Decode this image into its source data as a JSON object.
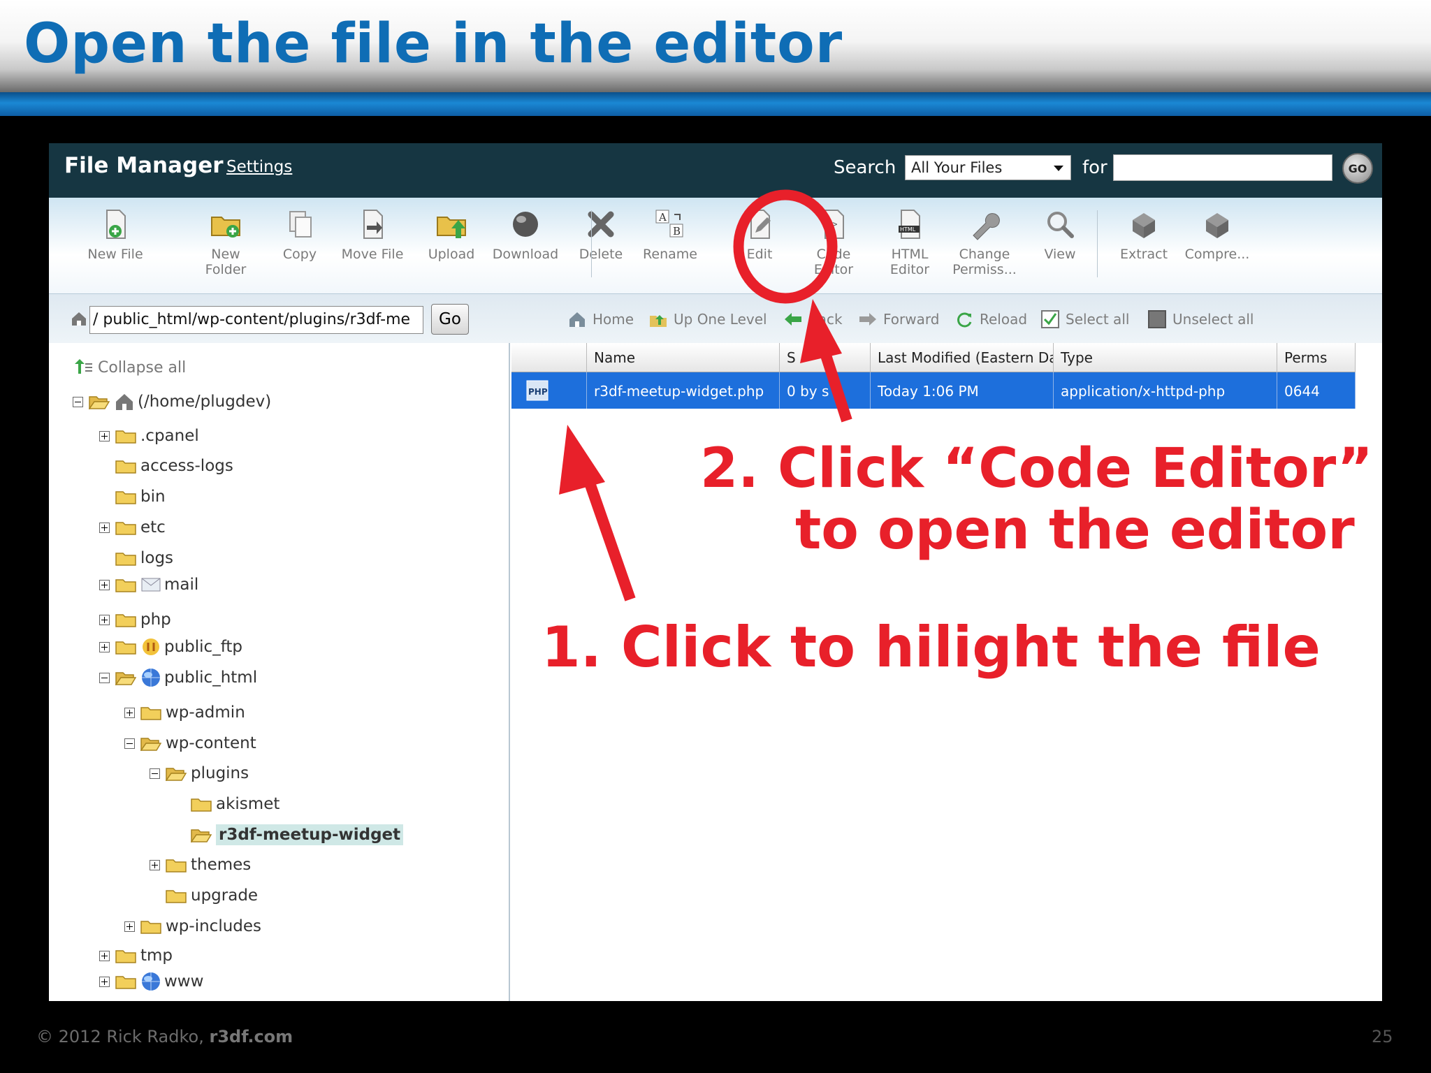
{
  "slide": {
    "title": "Open the file in the editor",
    "footer_copyright": "© 2012  Rick Radko, ",
    "footer_site": "r3df.com",
    "page_number": "25"
  },
  "file_manager": {
    "title": "File Manager",
    "settings_link": "Settings",
    "search_label": "Search",
    "search_scope": "All Your Files",
    "for_label": "for",
    "search_value": "",
    "go_label": "GO"
  },
  "toolbar": {
    "new_file": "New File",
    "new_folder": "New\nFolder",
    "copy": "Copy",
    "move_file": "Move File",
    "upload": "Upload",
    "download": "Download",
    "delete": "Delete",
    "rename": "Rename",
    "edit": "Edit",
    "code_editor": "Code\nEditor",
    "html_editor": "HTML\nEditor",
    "change_permissions": "Change\nPermiss...",
    "view": "View",
    "extract": "Extract",
    "compress": "Compre..."
  },
  "pathbar": {
    "path": "/ public_html/wp-content/plugins/r3df-me",
    "go": "Go"
  },
  "navbar": {
    "home": "Home",
    "up_one_level": "Up One Level",
    "back": "Back",
    "forward": "Forward",
    "reload": "Reload",
    "select_all": "Select all",
    "unselect_all": "Unselect all"
  },
  "tree": {
    "collapse_all": "Collapse all",
    "nodes": [
      {
        "label": "(/home/plugdev)"
      },
      {
        "label": ".cpanel"
      },
      {
        "label": "access-logs"
      },
      {
        "label": "bin"
      },
      {
        "label": "etc"
      },
      {
        "label": "logs"
      },
      {
        "label": "mail"
      },
      {
        "label": "php"
      },
      {
        "label": "public_ftp"
      },
      {
        "label": "public_html"
      },
      {
        "label": "wp-admin"
      },
      {
        "label": "wp-content"
      },
      {
        "label": "plugins"
      },
      {
        "label": "akismet"
      },
      {
        "label": "r3df-meetup-widget"
      },
      {
        "label": "themes"
      },
      {
        "label": "upgrade"
      },
      {
        "label": "wp-includes"
      },
      {
        "label": "tmp"
      },
      {
        "label": "www"
      }
    ]
  },
  "file_table": {
    "headers": [
      "",
      "Name",
      "S",
      "Last Modified (Eastern Da",
      "Type",
      "Perms"
    ],
    "row": {
      "icon_label": "PHP",
      "name": "r3df-meetup-widget.php",
      "size": "0 by   s",
      "modified": "Today 1:06 PM",
      "type": "application/x-httpd-php",
      "perms": "0644"
    }
  },
  "annotations": {
    "step2_line1": "2. Click “Code Editor”",
    "step2_line2": "to open the editor",
    "step1": "1. Click to hilight the file"
  },
  "colors": {
    "title_blue": "#0f6db5",
    "annotation_red": "#e8202a",
    "selection_blue": "#1d6fdc",
    "header_dark": "#163642"
  }
}
